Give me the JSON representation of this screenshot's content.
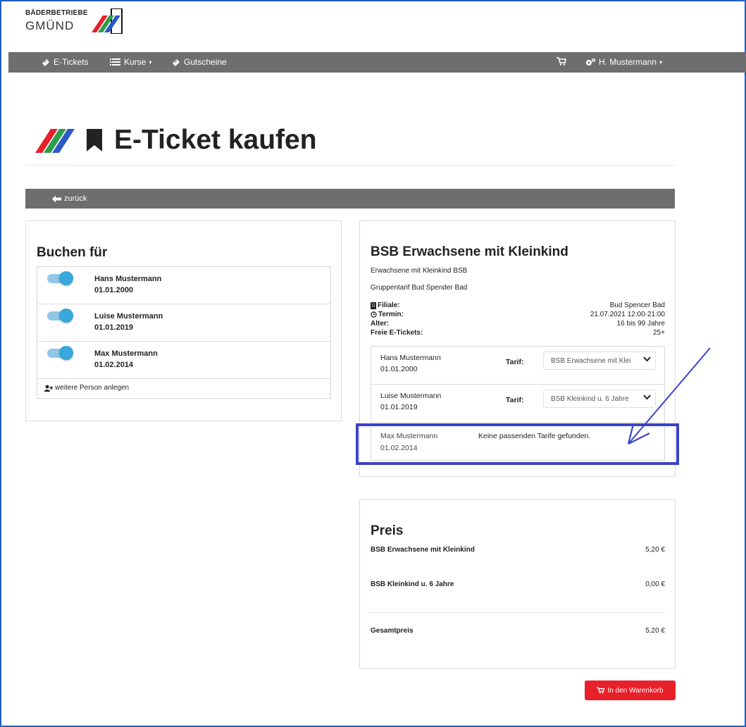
{
  "brand": {
    "line1": "BÄDERBETRIEBE",
    "line2": "GMÜND"
  },
  "nav": {
    "etickets": "E-Tickets",
    "kurse": "Kurse",
    "gutscheine": "Gutscheine",
    "user": "H. Mustermann"
  },
  "page": {
    "title": "E-Ticket kaufen",
    "back": "zurück"
  },
  "left": {
    "heading": "Buchen für",
    "persons": [
      {
        "name": "Hans Mustermann",
        "birth": "01.01.2000",
        "enabled": true
      },
      {
        "name": "Luise Mustermann",
        "birth": "01.01.2019",
        "enabled": true
      },
      {
        "name": "Max Mustermann",
        "birth": "01.02.2014",
        "enabled": true
      }
    ],
    "add_person": "weitere Person anlegen"
  },
  "offer": {
    "title": "BSB Erwachsene mit Kleinkind",
    "subtitle1": "Erwachsene mit Kleinkind BSB",
    "subtitle2": "Gruppentarif Bud Spender Bad",
    "info": [
      {
        "label": "Filiale:",
        "value": "Bud Spencer Bad",
        "icon": "building-icon"
      },
      {
        "label": "Termin:",
        "value": "21.07.2021 12:00-21:00",
        "icon": "clock-icon"
      },
      {
        "label": "Alter:",
        "value": "16 bis 99 Jahre"
      },
      {
        "label": "Freie E-Tickets:",
        "value": "25+"
      }
    ],
    "tarif_label": "Tarif:",
    "assignments": [
      {
        "name": "Hans Mustermann",
        "birth": "01.01.2000",
        "tarif": "BSB Erwachsene mit Klei"
      },
      {
        "name": "Luise Mustermann",
        "birth": "01.01.2019",
        "tarif": "BSB Kleinkind u. 6 Jahre"
      },
      {
        "name": "Max Mustermann",
        "birth": "01.02.2014",
        "message": "Keine passenden Tarife gefunden."
      }
    ]
  },
  "price": {
    "heading": "Preis",
    "items": [
      {
        "label": "BSB Erwachsene mit Kleinkind",
        "amount": "5,20 €"
      },
      {
        "label": "BSB Kleinkind u. 6 Jahre",
        "amount": "0,00 €"
      }
    ],
    "total_label": "Gesamtpreis",
    "total": "5,20 €"
  },
  "cart_button": "In den Warenkorb",
  "colors": {
    "nav": "#6e6e6e",
    "toggle": "#39a8dc",
    "cart": "#e8202a",
    "annotation": "#3b43c9"
  }
}
